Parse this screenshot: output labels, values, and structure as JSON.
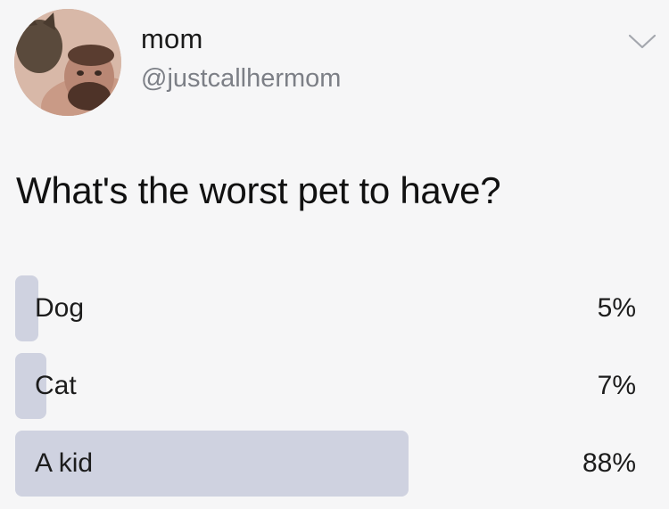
{
  "author": {
    "display_name": "mom",
    "handle": "@justcallhermom"
  },
  "question": "What's the worst pet to have?",
  "poll": {
    "options": [
      {
        "label": "Dog",
        "percent_text": "5%",
        "value": 5
      },
      {
        "label": "Cat",
        "percent_text": "7%",
        "value": 7
      },
      {
        "label": "A kid",
        "percent_text": "88%",
        "value": 88
      }
    ]
  },
  "colors": {
    "background": "#f6f6f7",
    "poll_fill": "#cfd2e0",
    "handle_text": "#7c7f86"
  },
  "icons": {
    "menu": "chevron-down-icon",
    "avatar": "profile-photo"
  }
}
